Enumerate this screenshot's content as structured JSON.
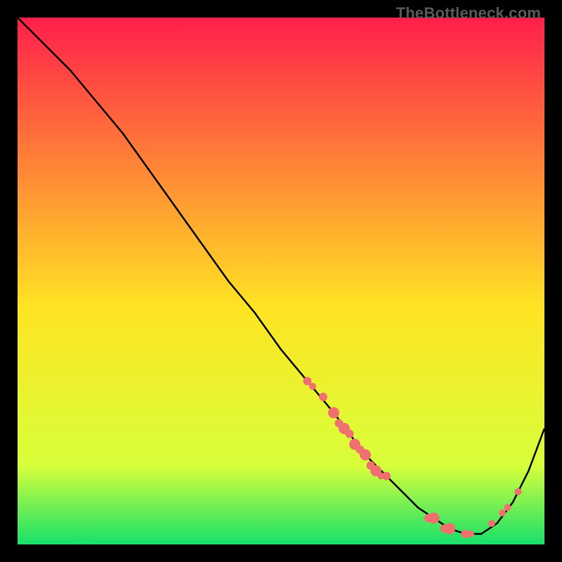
{
  "watermark": "TheBottleneck.com",
  "colors": {
    "gradient_top": "#ff1f4b",
    "gradient_mid": "#ffe423",
    "gradient_low": "#d8ff3a",
    "gradient_bottom": "#16e06a",
    "curve": "#000000",
    "marker_fill": "#f07070",
    "marker_stroke": "#c94a4a"
  },
  "chart_data": {
    "type": "line",
    "title": "",
    "xlabel": "",
    "ylabel": "",
    "xlim": [
      0,
      100
    ],
    "ylim": [
      0,
      100
    ],
    "grid": false,
    "legend": false,
    "series": [
      {
        "name": "curve",
        "x": [
          0,
          5,
          10,
          15,
          20,
          25,
          30,
          35,
          40,
          45,
          50,
          55,
          60,
          63,
          66,
          70,
          73,
          76,
          79,
          82,
          85,
          88,
          91,
          94,
          97,
          100
        ],
        "y": [
          100,
          95,
          90,
          84,
          78,
          71,
          64,
          57,
          50,
          44,
          37,
          31,
          25,
          21,
          17,
          13,
          10,
          7,
          5,
          3,
          2,
          2,
          4,
          8,
          14,
          22
        ]
      }
    ],
    "markers": [
      {
        "x": 55,
        "y": 31,
        "r": 6
      },
      {
        "x": 56,
        "y": 30,
        "r": 5
      },
      {
        "x": 58,
        "y": 28,
        "r": 6
      },
      {
        "x": 60,
        "y": 25,
        "r": 8
      },
      {
        "x": 61,
        "y": 23,
        "r": 6
      },
      {
        "x": 62,
        "y": 22,
        "r": 8
      },
      {
        "x": 63,
        "y": 21,
        "r": 6
      },
      {
        "x": 64,
        "y": 19,
        "r": 8
      },
      {
        "x": 65,
        "y": 18,
        "r": 6
      },
      {
        "x": 66,
        "y": 17,
        "r": 8
      },
      {
        "x": 67,
        "y": 15,
        "r": 6
      },
      {
        "x": 68,
        "y": 14,
        "r": 8
      },
      {
        "x": 69,
        "y": 13,
        "r": 5
      },
      {
        "x": 70,
        "y": 13,
        "r": 6
      },
      {
        "x": 78,
        "y": 5,
        "r": 6
      },
      {
        "x": 79,
        "y": 5,
        "r": 8
      },
      {
        "x": 81,
        "y": 3,
        "r": 6
      },
      {
        "x": 82,
        "y": 3,
        "r": 8
      },
      {
        "x": 85,
        "y": 2,
        "r": 6
      },
      {
        "x": 86,
        "y": 2,
        "r": 5
      },
      {
        "x": 90,
        "y": 4,
        "r": 5
      },
      {
        "x": 92,
        "y": 6,
        "r": 5
      },
      {
        "x": 93,
        "y": 7,
        "r": 5
      },
      {
        "x": 95,
        "y": 10,
        "r": 5
      }
    ]
  }
}
